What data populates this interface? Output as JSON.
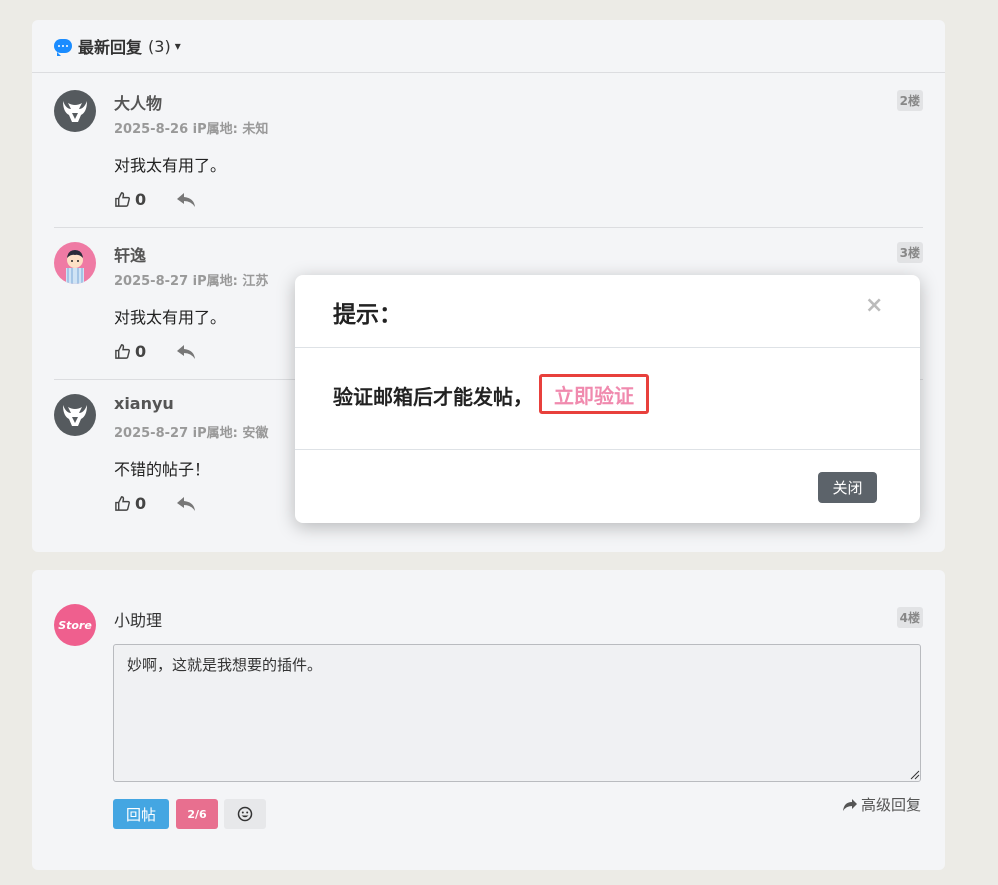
{
  "replies_section": {
    "title": "最新回复",
    "count": "(3)",
    "posts": [
      {
        "name": "大人物",
        "meta": "2025-8-26 iP属地: 未知",
        "content": "对我太有用了。",
        "likes": "0",
        "floor": "2楼"
      },
      {
        "name": "轩逸",
        "meta": "2025-8-27 iP属地: 江苏",
        "content": "对我太有用了。",
        "likes": "0",
        "floor": "3楼"
      },
      {
        "name": "xianyu",
        "meta": "2025-8-27 iP属地: 安徽",
        "content": "不错的帖子！",
        "likes": "0",
        "floor": ""
      }
    ]
  },
  "compose": {
    "name": "小助理",
    "floor": "4楼",
    "avatar_text": "Store",
    "textarea_value": "妙啊，这就是我想要的插件。",
    "post_button": "回帖",
    "counter": "2/6",
    "advanced_reply": "高级回复"
  },
  "modal": {
    "title": "提示：",
    "close_symbol": "×",
    "message": "验证邮箱后才能发帖，",
    "verify_link": "立即验证",
    "close_button": "关闭"
  },
  "colors": {
    "accent_blue": "#44a6e2",
    "verify_pink": "#f08aae",
    "highlight_red": "#e8403c",
    "counter_pink": "#e86f8f"
  }
}
